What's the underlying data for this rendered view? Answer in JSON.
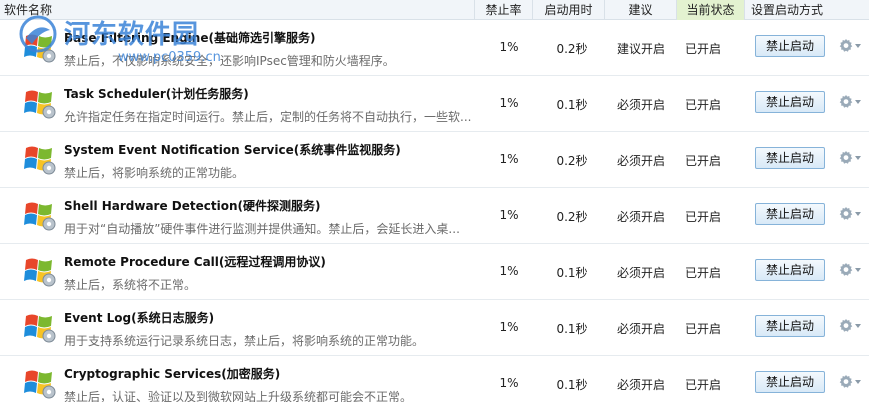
{
  "header": {
    "name": "软件名称",
    "rate": "禁止率",
    "time": "启动用时",
    "advice": "建议",
    "status": "当前状态",
    "mode": "设置启动方式"
  },
  "watermark": {
    "title": "河东软件园",
    "url": "www.pc0359.cn"
  },
  "rows": [
    {
      "name": "Base Filtering Engine(基础筛选引擎服务)",
      "desc": "禁止后，不仅影响系统安全，还影响IPsec管理和防火墙程序。",
      "rate": "1%",
      "time": "0.2秒",
      "advice": "建议开启",
      "status": "已开启",
      "button": "禁止启动"
    },
    {
      "name": "Task Scheduler(计划任务服务)",
      "desc": "允许指定任务在指定时间运行。禁止后，定制的任务将不自动执行，一些软...",
      "rate": "1%",
      "time": "0.1秒",
      "advice": "必须开启",
      "status": "已开启",
      "button": "禁止启动"
    },
    {
      "name": "System Event Notification Service(系统事件监视服务)",
      "desc": "禁止后，将影响系统的正常功能。",
      "rate": "1%",
      "time": "0.2秒",
      "advice": "必须开启",
      "status": "已开启",
      "button": "禁止启动"
    },
    {
      "name": "Shell Hardware Detection(硬件探测服务)",
      "desc": "用于对“自动播放”硬件事件进行监测并提供通知。禁止后，会延长进入桌...",
      "rate": "1%",
      "time": "0.2秒",
      "advice": "必须开启",
      "status": "已开启",
      "button": "禁止启动"
    },
    {
      "name": "Remote Procedure Call(远程过程调用协议)",
      "desc": "禁止后，系统将不正常。",
      "rate": "1%",
      "time": "0.1秒",
      "advice": "必须开启",
      "status": "已开启",
      "button": "禁止启动"
    },
    {
      "name": "Event Log(系统日志服务)",
      "desc": "用于支持系统运行记录系统日志，禁止后，将影响系统的正常功能。",
      "rate": "1%",
      "time": "0.1秒",
      "advice": "必须开启",
      "status": "已开启",
      "button": "禁止启动"
    },
    {
      "name": "Cryptographic Services(加密服务)",
      "desc": "禁止后，认证、验证以及到微软网站上升级系统都可能会不正常。",
      "rate": "1%",
      "time": "0.1秒",
      "advice": "必须开启",
      "status": "已开启",
      "button": "禁止启动"
    }
  ]
}
